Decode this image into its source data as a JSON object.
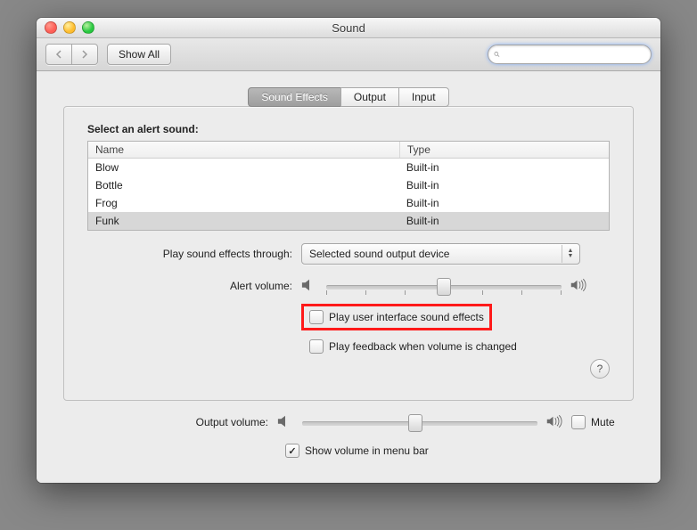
{
  "window": {
    "title": "Sound"
  },
  "toolbar": {
    "show_all": "Show All",
    "search_placeholder": ""
  },
  "tabs": [
    {
      "label": "Sound Effects",
      "active": true
    },
    {
      "label": "Output",
      "active": false
    },
    {
      "label": "Input",
      "active": false
    }
  ],
  "alert_sounds": {
    "heading": "Select an alert sound:",
    "columns": {
      "name": "Name",
      "type": "Type"
    },
    "rows": [
      {
        "name": "Blow",
        "type": "Built-in",
        "selected": false
      },
      {
        "name": "Bottle",
        "type": "Built-in",
        "selected": false
      },
      {
        "name": "Frog",
        "type": "Built-in",
        "selected": false
      },
      {
        "name": "Funk",
        "type": "Built-in",
        "selected": true
      }
    ]
  },
  "play_through": {
    "label": "Play sound effects through:",
    "value": "Selected sound output device"
  },
  "alert_volume": {
    "label": "Alert volume:",
    "percent": 50
  },
  "checkboxes": {
    "ui_sounds": {
      "label": "Play user interface sound effects",
      "checked": false,
      "highlighted": true
    },
    "feedback": {
      "label": "Play feedback when volume is changed",
      "checked": false
    }
  },
  "output_volume": {
    "label": "Output volume:",
    "percent": 48,
    "mute_label": "Mute",
    "mute_checked": false
  },
  "show_in_menubar": {
    "label": "Show volume in menu bar",
    "checked": true
  }
}
